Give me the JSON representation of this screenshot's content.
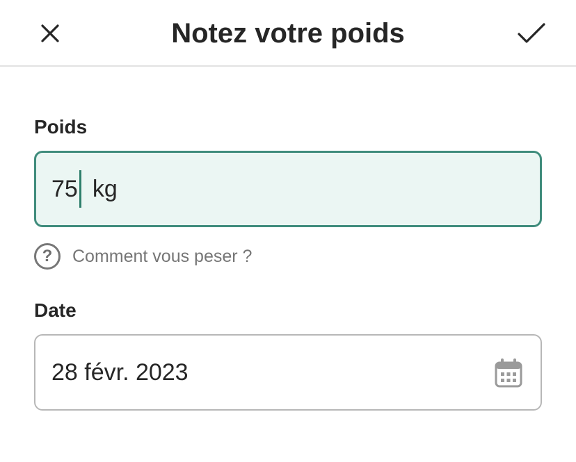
{
  "header": {
    "title": "Notez votre poids",
    "close_icon": "close-icon",
    "confirm_icon": "checkmark-icon"
  },
  "weight": {
    "label": "Poids",
    "value": "75",
    "unit": "kg",
    "help_icon": "question-circle-icon",
    "help_text": "Comment vous peser ?"
  },
  "date": {
    "label": "Date",
    "value": "28 févr. 2023",
    "icon": "calendar-icon"
  },
  "colors": {
    "accent": "#3f8c7c",
    "input_active_bg": "#ebf6f3",
    "text": "#262626",
    "muted": "#767676",
    "border": "#b7b7b7"
  }
}
